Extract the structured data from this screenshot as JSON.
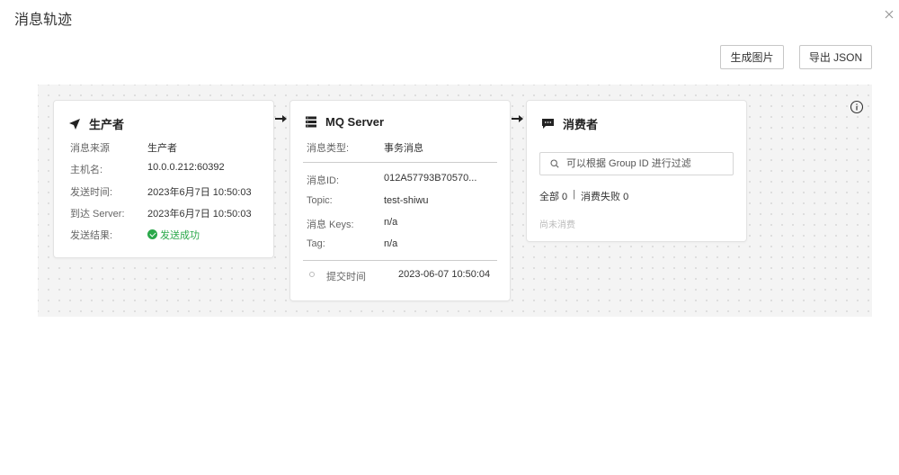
{
  "dialog": {
    "title": "消息轨迹",
    "close_icon": "close-icon"
  },
  "toolbar": {
    "generate_image_label": "生成图片",
    "export_json_label": "导出 JSON"
  },
  "producer": {
    "title": "生产者",
    "icon": "send-icon",
    "rows": [
      {
        "key": "消息来源",
        "value": "生产者"
      },
      {
        "key": "主机名:",
        "value": "10.0.0.212:60392"
      },
      {
        "key": "发送时间:",
        "value": "2023年6月7日 10:50:03"
      },
      {
        "key": "到达 Server:",
        "value": "2023年6月7日 10:50:03"
      },
      {
        "key": "发送结果:",
        "value": "发送成功"
      }
    ],
    "status_color": "#2aa84a"
  },
  "mq_server": {
    "title": "MQ Server",
    "icon": "server-icon",
    "type_key": "消息类型:",
    "type_value": "事务消息",
    "rows": [
      {
        "key": "消息ID:",
        "value": "012A57793B70570..."
      },
      {
        "key": "Topic:",
        "value": "test-shiwu"
      },
      {
        "key": "消息 Keys:",
        "value": "n/a"
      },
      {
        "key": "Tag:",
        "value": "n/a"
      }
    ],
    "timeline_key": "提交时间",
    "timeline_value": "2023-06-07 10:50:04"
  },
  "consumer": {
    "title": "消费者",
    "icon": "message-icon",
    "search_placeholder": "可以根据 Group ID 进行过滤",
    "stats_all": "全部 0",
    "stats_sep": "|",
    "stats_failed": "消费失败 0",
    "empty_text": "尚未消费"
  }
}
